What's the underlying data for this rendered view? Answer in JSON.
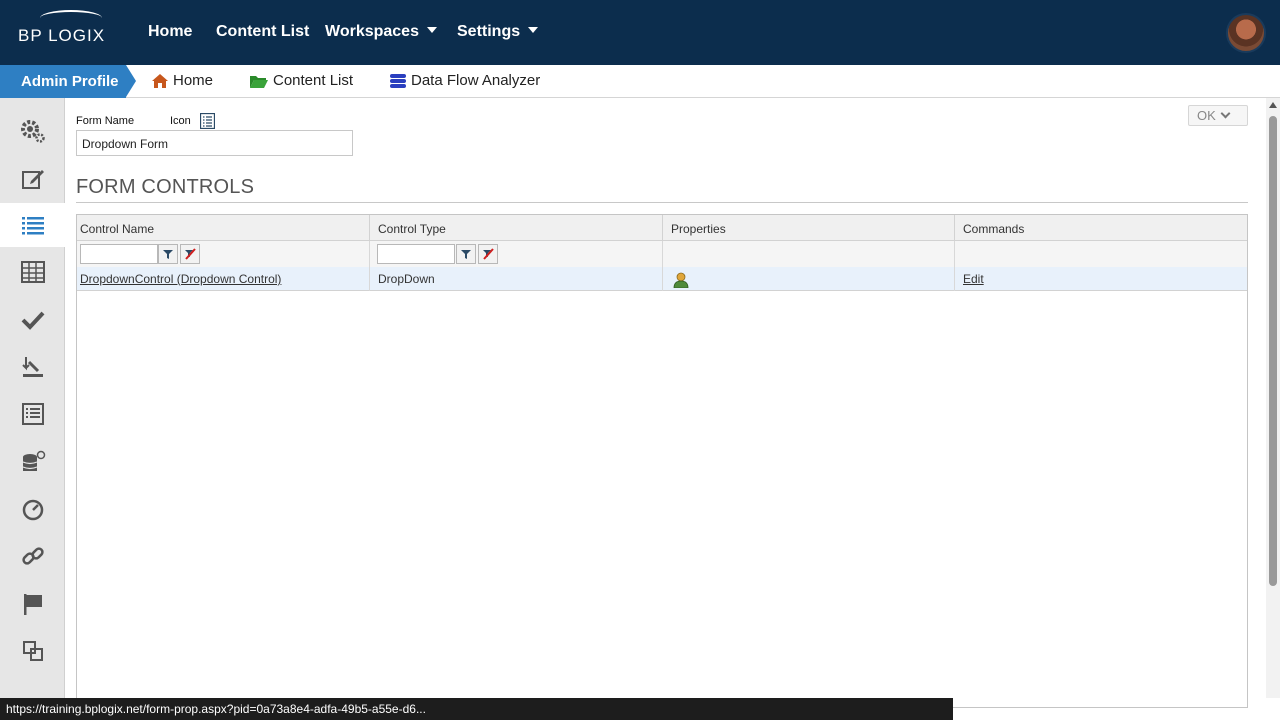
{
  "brand": {
    "logo_text": "BP LOGIX"
  },
  "topnav": {
    "items": [
      {
        "label": "Home"
      },
      {
        "label": "Content List"
      },
      {
        "label": "Workspaces"
      },
      {
        "label": "Settings"
      }
    ]
  },
  "breadcrumb": {
    "admin_profile": "Admin Profile",
    "items": [
      {
        "label": "Home",
        "icon": "home-icon"
      },
      {
        "label": "Content List",
        "icon": "folder-open-icon"
      },
      {
        "label": "Data Flow Analyzer",
        "icon": "database-icon"
      }
    ]
  },
  "sidebar": {
    "icons": [
      "gears-icon",
      "edit-icon",
      "list-icon",
      "table-icon",
      "check-icon",
      "download-icon",
      "document-list-icon",
      "database-add-icon",
      "gauge-icon",
      "link-icon",
      "flag-icon",
      "clone-icon"
    ]
  },
  "form": {
    "form_name_label": "Form Name",
    "icon_label": "Icon",
    "form_name_value": "Dropdown Form",
    "ok_label": "OK"
  },
  "controls": {
    "section_title": "FORM CONTROLS",
    "columns": [
      "Control Name",
      "Control Type",
      "Properties",
      "Commands"
    ],
    "rows": [
      {
        "name": "DropdownControl (Dropdown Control)",
        "type": "DropDown",
        "command": "Edit"
      }
    ]
  },
  "status": {
    "url": "https://training.bplogix.net/form-prop.aspx?pid=0a73a8e4-adfa-49b5-a55e-d6..."
  },
  "colors": {
    "topbar": "#0c2d4d",
    "accent": "#2e7fc3",
    "row_highlight": "#e8f1fb"
  }
}
